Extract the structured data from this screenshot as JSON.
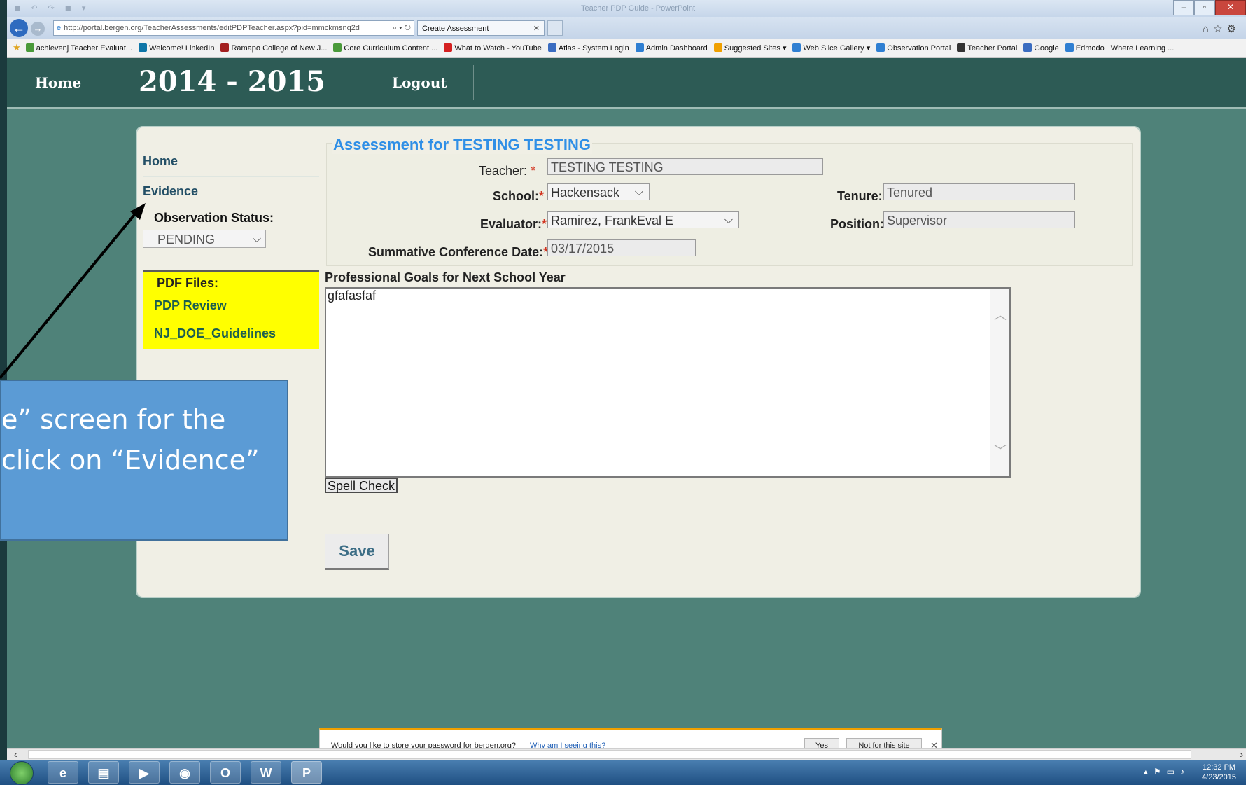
{
  "browser": {
    "window_title": "Teacher PDP Guide - PowerPoint",
    "url": "http://portal.bergen.org/TeacherAssessments/editPDPTeacher.aspx?pid=mmckmsnq2d",
    "tab_title": "Create Assessment",
    "favorites": [
      {
        "label": "achievenj Teacher Evaluat...",
        "color": "#4a9a3a"
      },
      {
        "label": "Welcome! LinkedIn",
        "color": "#0e76a8"
      },
      {
        "label": "Ramapo College of New J...",
        "color": "#a31f1f"
      },
      {
        "label": "Core Curriculum Content ...",
        "color": "#4a9a3a"
      },
      {
        "label": "What to Watch - YouTube",
        "color": "#d42020"
      },
      {
        "label": "Atlas - System Login",
        "color": "#3a6cc0"
      },
      {
        "label": "Admin Dashboard",
        "color": "#2f7fd2"
      },
      {
        "label": "Suggested Sites ▾",
        "color": "#f0a000"
      },
      {
        "label": "Web Slice Gallery ▾",
        "color": "#2f7fd2"
      },
      {
        "label": "Observation Portal",
        "color": "#2f7fd2"
      },
      {
        "label": "Teacher Portal",
        "color": "#333333"
      },
      {
        "label": "Google",
        "color": "#3a6cc0"
      },
      {
        "label": "Edmodo",
        "color": "#2f7fd2"
      },
      {
        "label": "Where Learning ...",
        "color": ""
      }
    ]
  },
  "header": {
    "home": "Home",
    "year": "2014 - 2015",
    "logout": "Logout"
  },
  "sidebar": {
    "home": "Home",
    "evidence": "Evidence",
    "observation_status_label": "Observation Status:",
    "observation_status_value": "PENDING",
    "pdf_title": "PDF Files:",
    "pdf_links": [
      "PDP Review",
      "NJ_DOE_Guidelines"
    ]
  },
  "form": {
    "title": "Assessment for TESTING TESTING",
    "teacher_label": "Teacher:",
    "teacher_value": "TESTING  TESTING",
    "school_label": "School:",
    "school_value": "Hackensack",
    "tenure_label": "Tenure:",
    "tenure_value": "Tenured",
    "evaluator_label": "Evaluator:",
    "evaluator_value": "Ramirez, FrankEval E",
    "position_label": "Position:",
    "position_value": "Supervisor",
    "conference_label": "Summative Conference Date:",
    "conference_value": "03/17/2015",
    "required_mark": "*",
    "goals_label": "Professional Goals for Next School Year",
    "goals_value": "gfafasfaf",
    "spell_check": "Spell Check",
    "save": "Save"
  },
  "callout": {
    "line1": "e” screen for the",
    "line2": "click on “Evidence”"
  },
  "password_bar": {
    "question": "Would you like to store your password for bergen.org?",
    "why": "Why am I seeing this?",
    "yes": "Yes",
    "no": "Not for this site"
  },
  "taskbar": {
    "time": "12:32 PM",
    "date": "4/23/2015"
  }
}
